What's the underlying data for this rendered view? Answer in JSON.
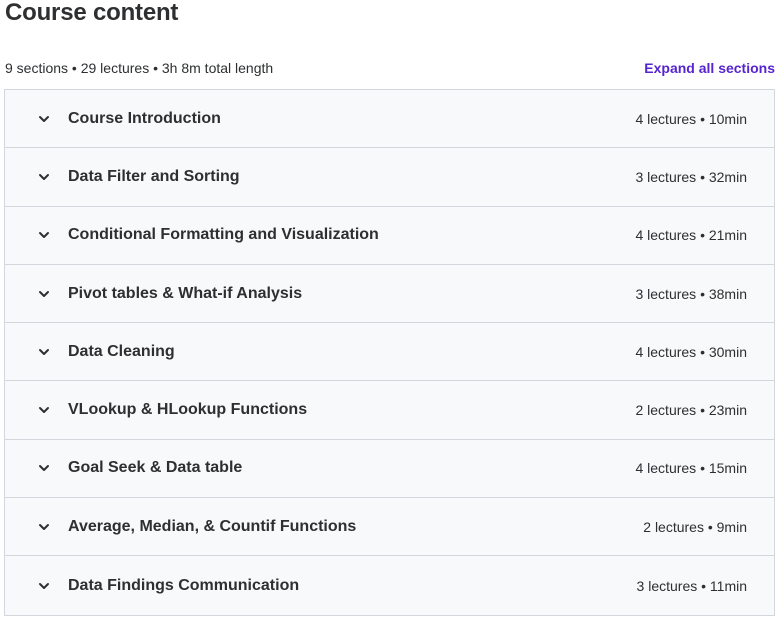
{
  "header": {
    "title": "Course content"
  },
  "summary": {
    "text": "9 sections • 29 lectures • 3h 8m total length",
    "expand_all_label": "Expand all sections"
  },
  "colors": {
    "accent": "#5624d0",
    "border": "#d1d7dc",
    "section_bg": "#f7f9fa",
    "text": "#2d2f31"
  },
  "icons": {
    "section_toggle": "chevron-down-icon"
  },
  "sections": [
    {
      "title": "Course Introduction",
      "meta": "4 lectures • 10min"
    },
    {
      "title": "Data Filter and Sorting",
      "meta": "3 lectures • 32min"
    },
    {
      "title": "Conditional Formatting and Visualization",
      "meta": "4 lectures • 21min"
    },
    {
      "title": "Pivot tables & What-if Analysis",
      "meta": "3 lectures • 38min"
    },
    {
      "title": "Data Cleaning",
      "meta": "4 lectures • 30min"
    },
    {
      "title": "VLookup & HLookup Functions",
      "meta": "2 lectures • 23min"
    },
    {
      "title": "Goal Seek & Data table",
      "meta": "4 lectures • 15min"
    },
    {
      "title": "Average, Median, & Countif Functions",
      "meta": "2 lectures • 9min"
    },
    {
      "title": "Data Findings Communication",
      "meta": "3 lectures • 11min"
    }
  ]
}
